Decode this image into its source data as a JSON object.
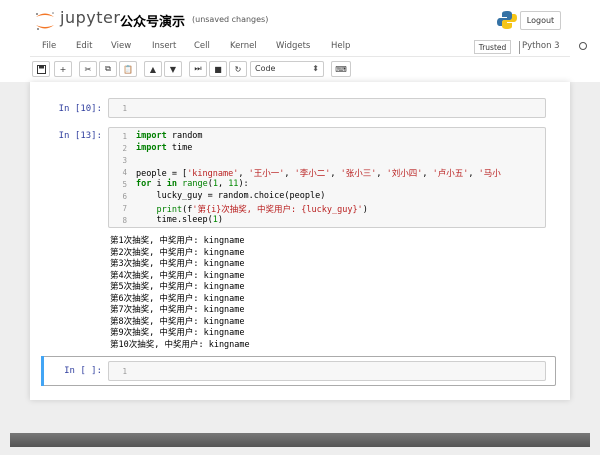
{
  "header": {
    "logo_text": "jupyter",
    "notebook_title": "公众号演示",
    "save_status": "(unsaved changes)",
    "logout_label": "Logout"
  },
  "menubar": {
    "items": [
      "File",
      "Edit",
      "View",
      "Insert",
      "Cell",
      "Kernel",
      "Widgets",
      "Help"
    ],
    "trusted_label": "Trusted",
    "kernel_name": "Python 3"
  },
  "toolbar": {
    "cell_type": "Code"
  },
  "cells": [
    {
      "prompt": "In [10]:",
      "lines": [
        "1"
      ]
    },
    {
      "prompt": "In [13]:",
      "line_numbers": [
        "1",
        "2",
        "3",
        "4",
        "5",
        "6",
        "7",
        "8"
      ],
      "code": [
        "import random",
        "import time",
        "",
        "people = ['kingname', '王小一', '李小二', '张小三', '刘小四', '卢小五', '马小",
        "for i in range(1, 11):",
        "    lucky_guy = random.choice(people)",
        "    print(f'第{i}次抽奖, 中奖用户: {lucky_guy}')",
        "    time.sleep(1)"
      ],
      "output": [
        "第1次抽奖, 中奖用户: kingname",
        "第2次抽奖, 中奖用户: kingname",
        "第3次抽奖, 中奖用户: kingname",
        "第4次抽奖, 中奖用户: kingname",
        "第5次抽奖, 中奖用户: kingname",
        "第6次抽奖, 中奖用户: kingname",
        "第7次抽奖, 中奖用户: kingname",
        "第8次抽奖, 中奖用户: kingname",
        "第9次抽奖, 中奖用户: kingname",
        "第10次抽奖, 中奖用户: kingname"
      ]
    },
    {
      "prompt": "In [ ]:",
      "lines": [
        "1"
      ]
    }
  ],
  "colors": {
    "prompt": "#303f9f",
    "keyword": "#008000",
    "string": "#ba2121",
    "selected": "#42a5f5"
  }
}
